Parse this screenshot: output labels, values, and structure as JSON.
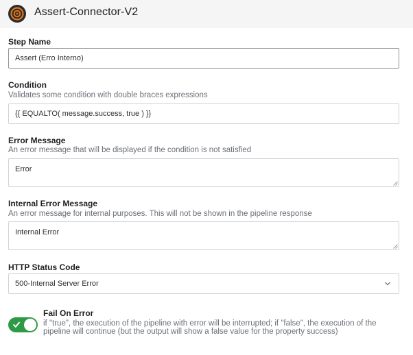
{
  "header": {
    "title": "Assert-Connector-V2",
    "logo_icon": "target-logo-icon",
    "logo_color": "#e2761b"
  },
  "step_name": {
    "label": "Step Name",
    "value": "Assert (Erro Interno)"
  },
  "condition": {
    "label": "Condition",
    "description": "Validates some condition with double braces expressions",
    "value": "{{ EQUALTO( message.success, true ) }}"
  },
  "error_message": {
    "label": "Error Message",
    "description": "An error message that will be displayed if the condition is not satisfied",
    "value": "Error"
  },
  "internal_error_message": {
    "label": "Internal Error Message",
    "description": "An error message for internal purposes. This will not be shown in the pipeline response",
    "value": "Internal Error"
  },
  "http_status_code": {
    "label": "HTTP Status Code",
    "selected": "500-Internal Server Error"
  },
  "fail_on_error": {
    "label": "Fail On Error",
    "description": "if \"true\", the execution of the pipeline with error will be interrupted; if \"false\", the execution of the pipeline will continue (but the output will show a false value for the property success)",
    "enabled": true,
    "toggle_color": "#2e9a46"
  }
}
